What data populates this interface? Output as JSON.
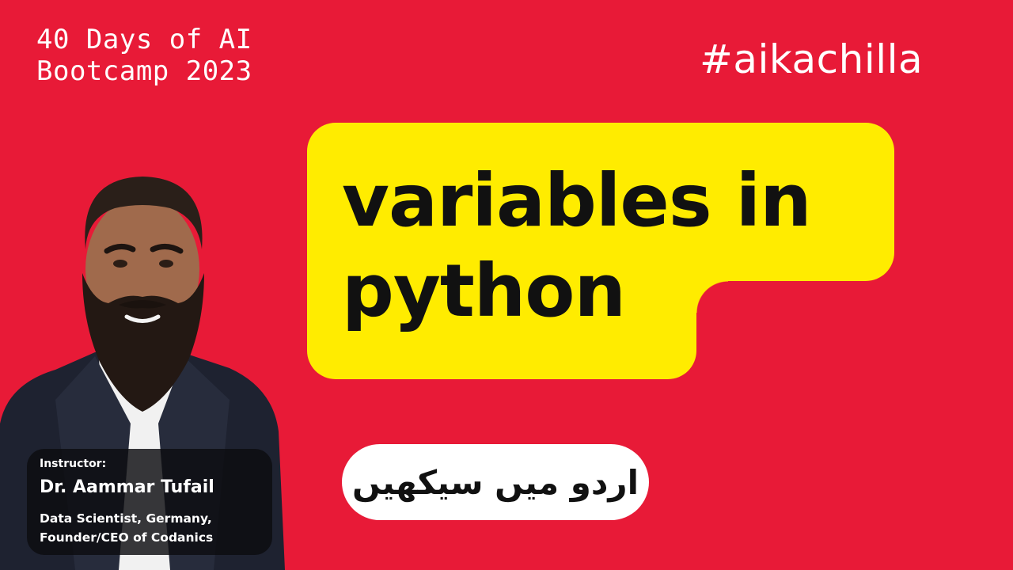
{
  "bootcamp": {
    "line1": "40 Days of AI",
    "line2": "Bootcamp 2023"
  },
  "hashtag": "#aikachilla",
  "title": {
    "line1": "variables in",
    "line2": "python"
  },
  "urdu_label": "اردو میں سیکھیں",
  "instructor": {
    "label": "Instructor:",
    "name": "Dr. Aammar Tufail",
    "role_line1": "Data Scientist, Germany,",
    "role_line2": "Founder/CEO of Codanics"
  },
  "colors": {
    "background": "#E81A37",
    "title_box": "#FFEC00",
    "pill": "#FFFFFF"
  }
}
